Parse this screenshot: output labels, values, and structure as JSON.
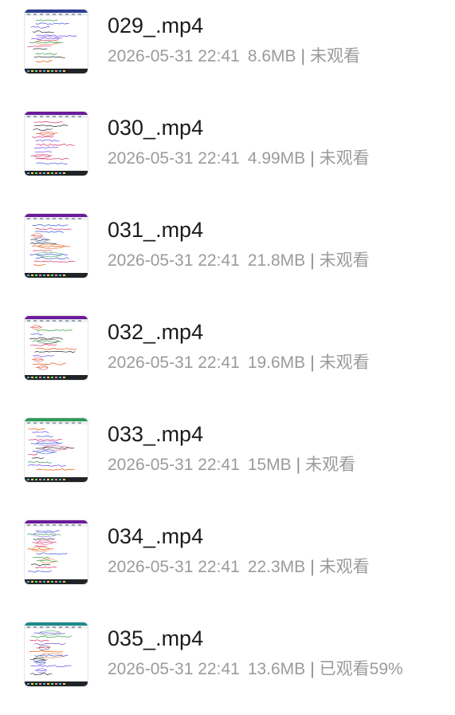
{
  "files": [
    {
      "name": "029_.mp4",
      "date": "2026-05-31 22:41",
      "size": "8.6MB",
      "status": "未观看",
      "theme": "blue",
      "icon": "video-thumbnail"
    },
    {
      "name": "030_.mp4",
      "date": "2026-05-31 22:41",
      "size": "4.99MB",
      "status": "未观看",
      "theme": "purple",
      "icon": "video-thumbnail"
    },
    {
      "name": "031_.mp4",
      "date": "2026-05-31 22:41",
      "size": "21.8MB",
      "status": "未观看",
      "theme": "purple",
      "icon": "video-thumbnail"
    },
    {
      "name": "032_.mp4",
      "date": "2026-05-31 22:41",
      "size": "19.6MB",
      "status": "未观看",
      "theme": "purple",
      "icon": "video-thumbnail"
    },
    {
      "name": "033_.mp4",
      "date": "2026-05-31 22:41",
      "size": "15MB",
      "status": "未观看",
      "theme": "green",
      "icon": "video-thumbnail"
    },
    {
      "name": "034_.mp4",
      "date": "2026-05-31 22:41",
      "size": "22.3MB",
      "status": "未观看",
      "theme": "purple",
      "icon": "video-thumbnail"
    },
    {
      "name": "035_.mp4",
      "date": "2026-05-31 22:41",
      "size": "13.6MB",
      "status": "已观看59%",
      "theme": "teal",
      "icon": "video-thumbnail"
    }
  ],
  "meta_separator": "|",
  "colors": {
    "title": "#1b1b1b",
    "meta": "#9b9b9b",
    "blue": "#2c3e8f",
    "purple": "#6a1b9a",
    "green": "#2e9b5a",
    "teal": "#1e8a8a"
  }
}
